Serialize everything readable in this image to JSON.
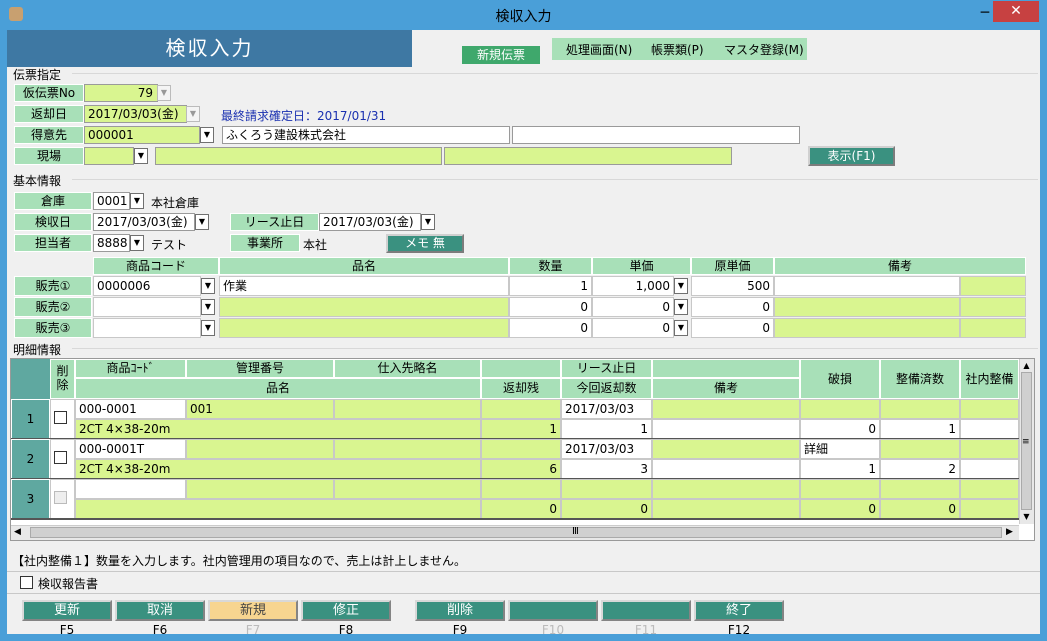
{
  "window": {
    "title": "検収入力",
    "min": "─",
    "max": "□",
    "close": "✕"
  },
  "header": {
    "title": "検収入力",
    "new_badge": "新規伝票",
    "menus": [
      "処理画面(N)",
      "帳票類(P)",
      "マスタ登録(M)"
    ]
  },
  "denpyo": {
    "section": "伝票指定",
    "kari_label": "仮伝票No",
    "kari_value": "79",
    "henkyaku_label": "返却日",
    "henkyaku_value": "2017/03/03(金)",
    "saishu_text": "最終請求確定日：2017/01/31",
    "tokuisaki_label": "得意先",
    "tokuisaki_code": "000001",
    "tokuisaki_name": "ふくろう建設株式会社",
    "genba_label": "現場",
    "show_button": "表示(F1)"
  },
  "kihon": {
    "section": "基本情報",
    "soko_label": "倉庫",
    "soko_code": "0001",
    "soko_name": "本社倉庫",
    "kenshu_label": "検収日",
    "kenshu_value": "2017/03/03(金)",
    "lease_label": "リース止日",
    "lease_value": "2017/03/03(金)",
    "tanto_label": "担当者",
    "tanto_code": "8888",
    "tanto_name": "テスト",
    "jigyo_label": "事業所",
    "jigyo_value": "本社",
    "memo_button": "メモ 無"
  },
  "hanbai": {
    "headers": [
      "商品コード",
      "品名",
      "数量",
      "単価",
      "原単価",
      "備考"
    ],
    "rows": [
      {
        "label": "販売①",
        "code": "0000006",
        "name": "作業",
        "qty": "1",
        "price": "1,000",
        "cost": "500",
        "note": ""
      },
      {
        "label": "販売②",
        "code": "",
        "name": "",
        "qty": "0",
        "price": "0",
        "cost": "0",
        "note": ""
      },
      {
        "label": "販売③",
        "code": "",
        "name": "",
        "qty": "0",
        "price": "0",
        "cost": "0",
        "note": ""
      }
    ]
  },
  "meisai": {
    "section": "明細情報",
    "h_delete": "削除",
    "h_code": "商品ｺｰﾄﾞ",
    "h_kanri": "管理番号",
    "h_shiire": "仕入先略名",
    "h_lease": "リース止日",
    "h_hinmei": "品名",
    "h_zan": "返却残",
    "h_konkai": "今回返却数",
    "h_biko": "備考",
    "h_hason": "破損",
    "h_seibi": "整備済数",
    "h_shanai": "社内整備",
    "rows": [
      {
        "num": "1",
        "code": "000-0001",
        "kanri": "001",
        "shiire": "",
        "lease": "2017/03/03",
        "hinmei": "2CT 4×38-20m",
        "zan": "1",
        "konkai": "1",
        "biko": "",
        "hason_top": "",
        "hason": "0",
        "seibi": "1"
      },
      {
        "num": "2",
        "code": "000-0001T",
        "kanri": "",
        "shiire": "",
        "lease": "2017/03/03",
        "hinmei": "2CT 4×38-20m",
        "zan": "6",
        "konkai": "3",
        "biko": "",
        "hason_top": "詳細",
        "hason": "1",
        "seibi": "2"
      },
      {
        "num": "3",
        "code": "",
        "kanri": "",
        "shiire": "",
        "lease": "",
        "hinmei": "",
        "zan": "0",
        "konkai": "0",
        "biko": "",
        "hason_top": "",
        "hason": "0",
        "seibi": "0"
      }
    ],
    "scroll_grip": "Ⅲ"
  },
  "status": {
    "message": "【社内整備１】数量を入力します。社内管理用の項目なので、売上は計上しません。"
  },
  "report": {
    "label": "検収報告書"
  },
  "fbuttons": [
    {
      "label": "更新",
      "key": "F5",
      "active": true
    },
    {
      "label": "取消",
      "key": "F6",
      "active": true
    },
    {
      "label": "新規",
      "key": "F7",
      "active": false
    },
    {
      "label": "修正",
      "key": "F8",
      "active": true
    },
    {
      "label": "削除",
      "key": "F9",
      "active": true
    },
    {
      "label": "",
      "key": "F10",
      "active": true
    },
    {
      "label": "",
      "key": "F11",
      "active": true
    },
    {
      "label": "終了",
      "key": "F12",
      "active": true
    }
  ],
  "colors": {
    "accent": "#3e78a3",
    "label_green": "#a8e0b8",
    "input_yellow": "#d9f590",
    "button_teal": "#3a9180",
    "title_bar": "#4a9fd8"
  }
}
